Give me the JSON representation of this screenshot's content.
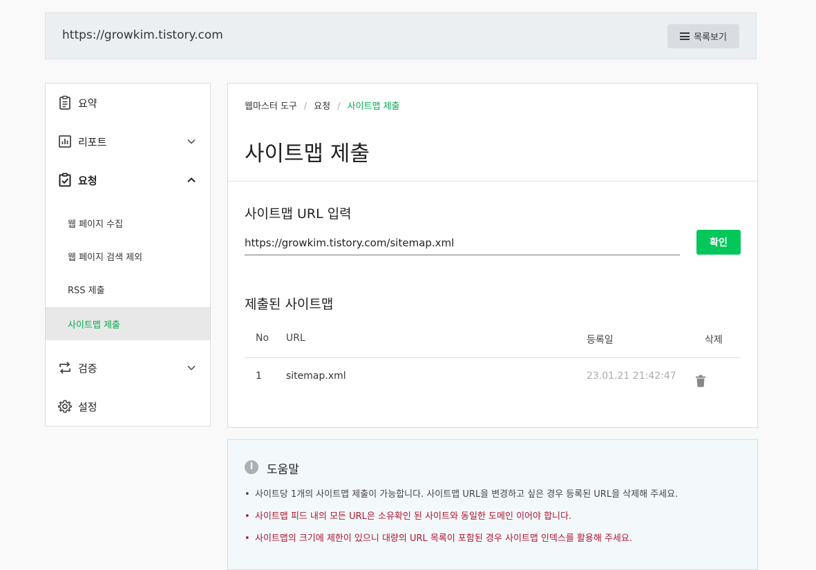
{
  "header": {
    "site_url": "https://growkim.tistory.com",
    "list_button_label": "목록보기"
  },
  "sidebar": {
    "items": [
      {
        "label": "요약",
        "icon": "clipboard-icon"
      },
      {
        "label": "리포트",
        "icon": "bar-chart-icon",
        "expanded": false
      },
      {
        "label": "요청",
        "icon": "clipboard-check-icon",
        "expanded": true
      },
      {
        "label": "검증",
        "icon": "swap-arrows-icon",
        "expanded": false
      },
      {
        "label": "설정",
        "icon": "gear-icon"
      }
    ],
    "sub_items": [
      {
        "label": "웹 페이지 수집"
      },
      {
        "label": "웹 페이지 검색 제외"
      },
      {
        "label": "RSS 제출"
      },
      {
        "label": "사이트맵 제출",
        "active": true
      }
    ]
  },
  "main": {
    "breadcrumb": [
      "웹마스터 도구",
      "요청",
      "사이트맵 제출"
    ],
    "title": "사이트맵 제출",
    "url_section_title": "사이트맵 URL 입력",
    "url_value": "https://growkim.tistory.com/sitemap.xml",
    "confirm_label": "확인",
    "submitted_title": "제출된 사이트맵",
    "table": {
      "headers": [
        "No",
        "URL",
        "등록일",
        "삭제"
      ],
      "rows": [
        {
          "no": "1",
          "url": "sitemap.xml",
          "date": "23.01.21 21:42:47"
        }
      ]
    }
  },
  "help": {
    "title": "도움말",
    "items": [
      "사이트당 1개의 사이트맵 제출이 가능합니다. 사이트맵 URL을 변경하고 싶은 경우 등록된 URL을 삭제해 주세요.",
      "사이트맵 피드 내의 모든 URL은 소유확인 된 사이트와 동일한 도메인 이어야 합니다.",
      "사이트맵의 크기에 제한이 있으니 대량의 URL 목록이 포함된 경우 사이트맵 인덱스를 활용해 주세요."
    ]
  },
  "colors": {
    "accent_green": "#03c75a",
    "active_green_text": "#03a94f",
    "warning_red": "#b0152e"
  }
}
